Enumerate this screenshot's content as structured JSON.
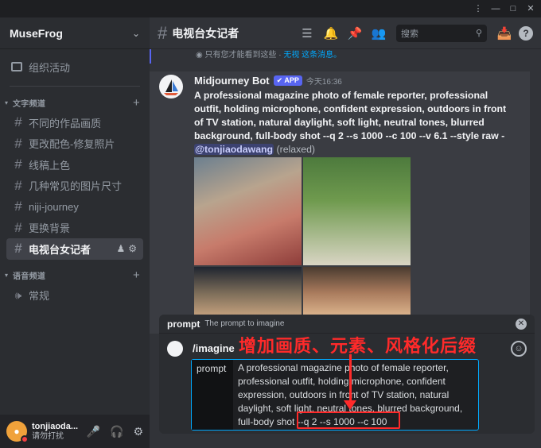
{
  "window": {
    "controls": [
      "⋮",
      "—",
      "□",
      "✕"
    ]
  },
  "server": {
    "name": "MuseFrog"
  },
  "sidebar": {
    "activity": "组织活动",
    "text_category": "文字频道",
    "channels": [
      {
        "name": "不同的作品画质"
      },
      {
        "name": "更改配色-修复照片"
      },
      {
        "name": "线稿上色"
      },
      {
        "name": "几种常见的图片尺寸"
      },
      {
        "name": "niji-journey"
      },
      {
        "name": "更换背景"
      },
      {
        "name": "电视台女记者"
      }
    ],
    "voice_category": "语音频道",
    "voice_channels": [
      {
        "name": "常规"
      }
    ]
  },
  "user": {
    "name": "tonjiaoda...",
    "status": "请勿打扰"
  },
  "header": {
    "channel": "电视台女记者",
    "search_placeholder": "搜索",
    "help": "?"
  },
  "ephemeral": {
    "text": "只有您才能看到这些 · ",
    "dismiss": "无视 这条消息。"
  },
  "message": {
    "author": "Midjourney Bot",
    "badge": "✔ APP",
    "time": "今天16:36",
    "text": "A professional magazine photo of female reporter, professional outfit, holding microphone, confident expression, outdoors in front of TV station, natural daylight, soft light, neutral tones, blurred background, full-body shot --q 2 --s 1000 --c 100 --v 6.1 --style raw - ",
    "mention": "@tonjiaodawang",
    "mode": "(relaxed)"
  },
  "command": {
    "option_name": "prompt",
    "option_desc": "The prompt to imagine",
    "name": "/imagine",
    "param_label": "prompt",
    "param_value": "A professional magazine photo of female reporter, professional outfit, holding microphone, confident expression, outdoors in front of TV station, natural daylight, soft light, neutral tones, blurred background, full-body shot --q 2 --s 1000 --c 100"
  },
  "annotation": {
    "text": "增加画质、元素、风格化后缀",
    "color": "#ff2a2a"
  },
  "colors": {
    "accent": "#5865f2",
    "link": "#00a8fc",
    "sidebar_bg": "#2b2d31",
    "main_bg": "#313338"
  }
}
